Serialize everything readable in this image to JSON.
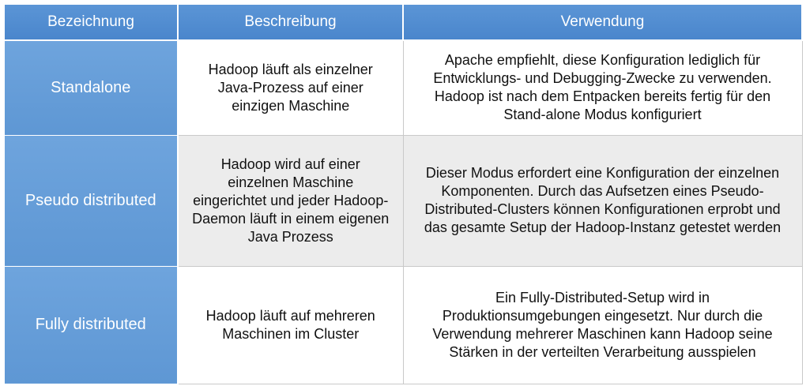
{
  "header": {
    "col1": "Bezeichnung",
    "col2": "Beschreibung",
    "col3": "Verwendung"
  },
  "rows": [
    {
      "name": "Standalone",
      "description": "Hadoop läuft als einzelner Java-Prozess auf einer einzigen Maschine",
      "usage": "Apache empfiehlt, diese Konfiguration lediglich für Entwicklungs- und Debugging-Zwecke zu verwenden. Hadoop ist nach dem Entpacken bereits fertig für den Stand-alone Modus konfiguriert"
    },
    {
      "name": "Pseudo distributed",
      "description": "Hadoop wird auf einer einzelnen Maschine eingerichtet und jeder Hadoop-Daemon läuft in einem eigenen Java Prozess",
      "usage": "Dieser Modus erfordert eine Konfiguration der einzelnen Komponenten. Durch das Aufsetzen eines Pseudo-Distributed-Clusters können Konfigurationen erprobt und das gesamte Setup der Hadoop-Instanz getestet werden"
    },
    {
      "name": "Fully distributed",
      "description": "Hadoop läuft auf mehreren Maschinen im Cluster",
      "usage": "Ein Fully-Distributed-Setup wird in Produktionsumgebungen eingesetzt. Nur durch die Verwendung mehrerer Maschinen kann Hadoop seine Stärken in der verteilten Verarbeitung ausspielen"
    }
  ],
  "colors": {
    "header_blue": "#4a86cc",
    "label_blue": "#6ea4dd",
    "alt_row_gray": "#ececec"
  }
}
